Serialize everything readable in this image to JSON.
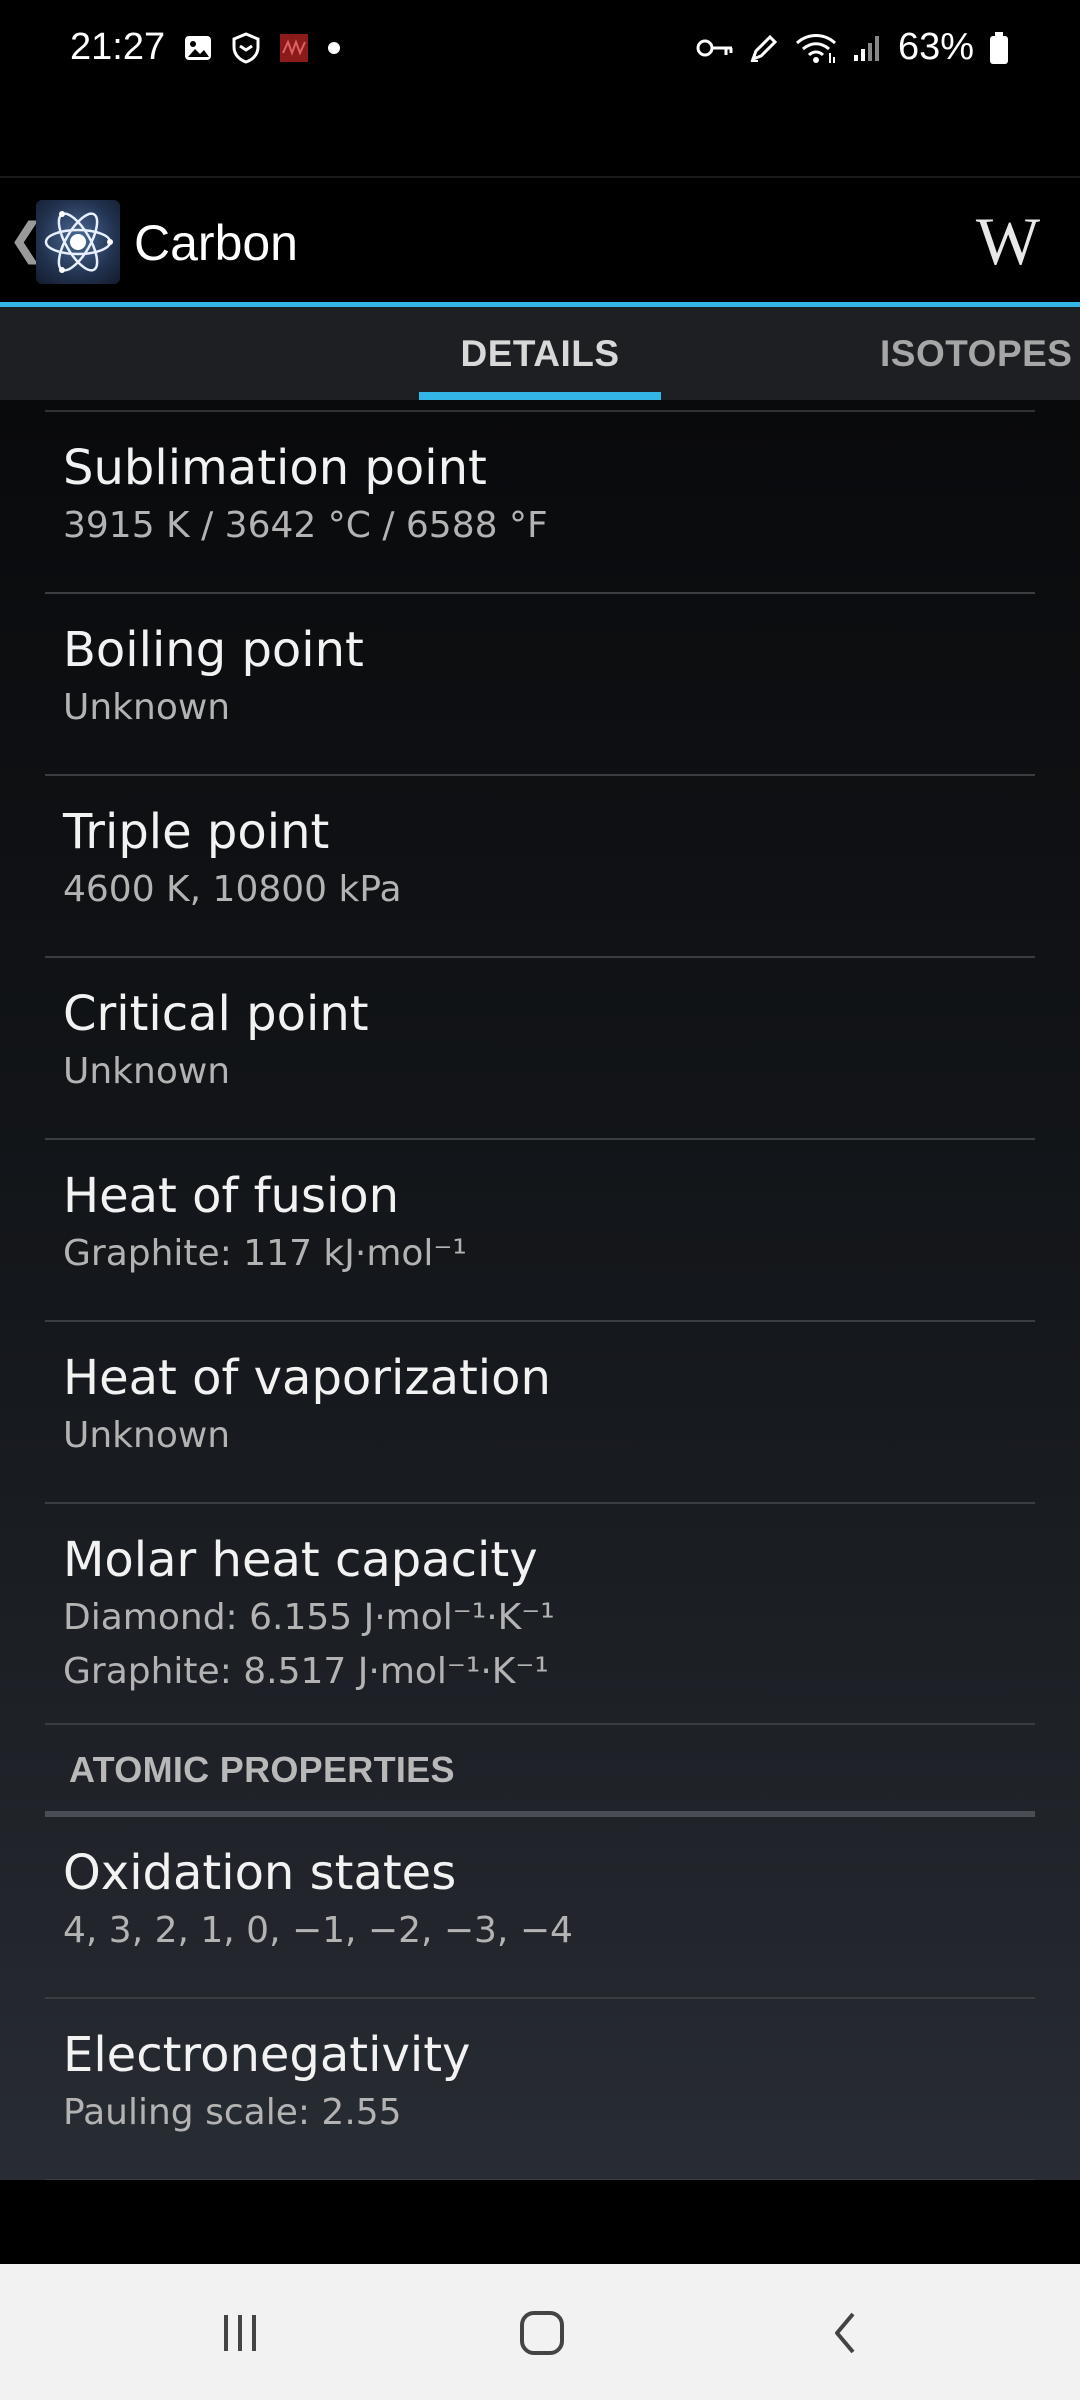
{
  "status_bar": {
    "time": "21:27",
    "left_icons": [
      "gallery-icon",
      "shield-icon",
      "app-notification-icon",
      "dot-icon"
    ],
    "right_icons": [
      "vpn-key-icon",
      "pen-icon",
      "wifi-icon",
      "signal-icon",
      "battery-icon"
    ],
    "battery_percent": "63%"
  },
  "app_bar": {
    "back_glyph": "❮",
    "title": "Carbon",
    "wiki_label": "W",
    "accent_color": "#33b5e5"
  },
  "tabs": [
    {
      "label": "DETAILS",
      "selected": true
    },
    {
      "label": "ISOTOPES",
      "selected": false
    }
  ],
  "properties_top": [
    {
      "label": "Sublimation point",
      "values": [
        "3915 K / 3642 °C / 6588 °F"
      ]
    },
    {
      "label": "Boiling point",
      "values": [
        "Unknown"
      ]
    },
    {
      "label": "Triple point",
      "values": [
        "4600 K, 10800 kPa"
      ]
    },
    {
      "label": "Critical point",
      "values": [
        "Unknown"
      ]
    },
    {
      "label": "Heat of fusion",
      "values": [
        "Graphite: 117 kJ·mol⁻¹"
      ]
    },
    {
      "label": "Heat of vaporization",
      "values": [
        "Unknown"
      ]
    },
    {
      "label": "Molar heat capacity",
      "values": [
        "Diamond: 6.155 J·mol⁻¹·K⁻¹",
        "Graphite: 8.517 J·mol⁻¹·K⁻¹"
      ]
    }
  ],
  "section": {
    "title": "ATOMIC PROPERTIES"
  },
  "properties_atomic": [
    {
      "label": "Oxidation states",
      "values": [
        "4, 3, 2, 1, 0, −1, −2, −3, −4"
      ]
    },
    {
      "label": "Electronegativity",
      "values": [
        "Pauling scale: 2.55"
      ]
    }
  ],
  "nav_bar": {
    "buttons": [
      "recent-apps",
      "home",
      "back"
    ]
  }
}
